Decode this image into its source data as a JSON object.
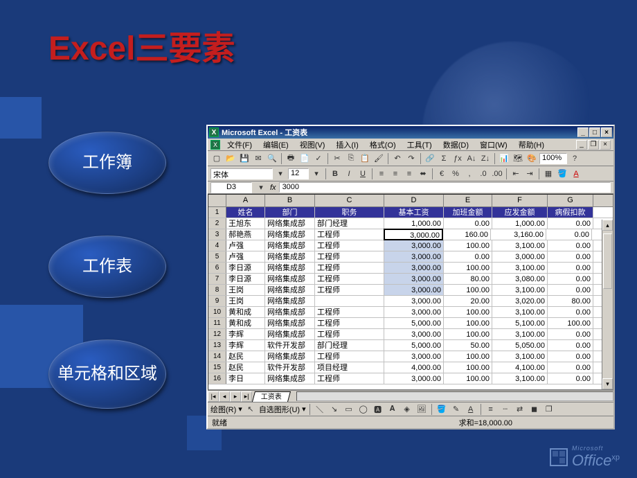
{
  "slide": {
    "title": "Excel三要素",
    "oval1": "工作簿",
    "oval2": "工作表",
    "oval3": "单元格和区域"
  },
  "window": {
    "title": "Microsoft Excel - 工资表",
    "minimize": "_",
    "maximize": "□",
    "close": "×"
  },
  "menus": [
    "文件(F)",
    "编辑(E)",
    "视图(V)",
    "插入(I)",
    "格式(O)",
    "工具(T)",
    "数据(D)",
    "窗口(W)",
    "帮助(H)"
  ],
  "format": {
    "font": "宋体",
    "size": "12",
    "zoom": "100%"
  },
  "cellref": {
    "name": "D3",
    "fx": "fx",
    "value": "3000"
  },
  "columns": [
    "A",
    "B",
    "C",
    "D",
    "E",
    "F",
    "G"
  ],
  "headers": [
    "姓名",
    "部门",
    "职务",
    "基本工资",
    "加班金额",
    "应发金额",
    "病假扣款"
  ],
  "rows": [
    {
      "n": 2,
      "c": [
        "王旭东",
        "网络集成部",
        "部门经理",
        "1,000.00",
        "0.00",
        "1,000.00",
        "0.00"
      ]
    },
    {
      "n": 3,
      "c": [
        "郝艳燕",
        "网络集成部",
        "工程师",
        "3,000.00",
        "160.00",
        "3,160.00",
        "0.00"
      ]
    },
    {
      "n": 4,
      "c": [
        "卢强",
        "网络集成部",
        "工程师",
        "3,000.00",
        "100.00",
        "3,100.00",
        "0.00"
      ]
    },
    {
      "n": 5,
      "c": [
        "卢强",
        "网络集成部",
        "工程师",
        "3,000.00",
        "0.00",
        "3,000.00",
        "0.00"
      ]
    },
    {
      "n": 6,
      "c": [
        "李日源",
        "网络集成部",
        "工程师",
        "3,000.00",
        "100.00",
        "3,100.00",
        "0.00"
      ]
    },
    {
      "n": 7,
      "c": [
        "李日源",
        "网络集成部",
        "工程师",
        "3,000.00",
        "80.00",
        "3,080.00",
        "0.00"
      ]
    },
    {
      "n": 8,
      "c": [
        "王岗",
        "网络集成部",
        "工程师",
        "3,000.00",
        "100.00",
        "3,100.00",
        "0.00"
      ]
    },
    {
      "n": 9,
      "c": [
        "王岗",
        "网络集成部",
        "",
        "3,000.00",
        "20.00",
        "3,020.00",
        "80.00"
      ]
    },
    {
      "n": 10,
      "c": [
        "黄和成",
        "网络集成部",
        "工程师",
        "3,000.00",
        "100.00",
        "3,100.00",
        "0.00"
      ]
    },
    {
      "n": 11,
      "c": [
        "黄和成",
        "网络集成部",
        "工程师",
        "5,000.00",
        "100.00",
        "5,100.00",
        "100.00"
      ]
    },
    {
      "n": 12,
      "c": [
        "李辉",
        "网络集成部",
        "工程师",
        "3,000.00",
        "100.00",
        "3,100.00",
        "0.00"
      ]
    },
    {
      "n": 13,
      "c": [
        "李辉",
        "软件开发部",
        "部门经理",
        "5,000.00",
        "50.00",
        "5,050.00",
        "0.00"
      ]
    },
    {
      "n": 14,
      "c": [
        "赵民",
        "网络集成部",
        "工程师",
        "3,000.00",
        "100.00",
        "3,100.00",
        "0.00"
      ]
    },
    {
      "n": 15,
      "c": [
        "赵民",
        "软件开发部",
        "项目经理",
        "4,000.00",
        "100.00",
        "4,100.00",
        "0.00"
      ]
    },
    {
      "n": 16,
      "c": [
        "李日",
        "网络集成部",
        "工程师",
        "3,000.00",
        "100.00",
        "3,100.00",
        "0.00"
      ]
    }
  ],
  "sheet_tab": "工资表",
  "draw": {
    "label1": "绘图(R)",
    "label2": "自选图形(U)"
  },
  "status": {
    "ready": "就绪",
    "sum": "求和=18,000.00"
  },
  "logo": {
    "ms": "Microsoft",
    "office": "Office",
    "xp": "xp"
  }
}
